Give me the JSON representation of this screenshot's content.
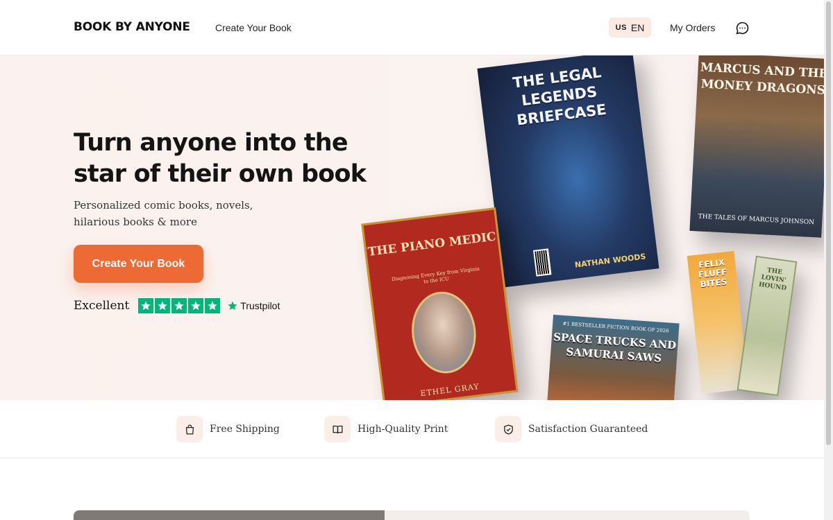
{
  "header": {
    "logo": "BOOK BY ANYONE",
    "nav_create": "Create Your Book",
    "lang_flag": "US",
    "lang_code": "EN",
    "my_orders": "My Orders",
    "chat_icon": "chat-bubble-icon"
  },
  "hero": {
    "title": "Turn anyone into the star of their own book",
    "subtitle": "Personalized comic books, novels, hilarious books & more",
    "cta": "Create Your Book",
    "rating_label": "Excellent",
    "trustpilot": "Trustpilot",
    "star_color": "#00b67a",
    "accent_color": "#ee6a35"
  },
  "books": {
    "legal": {
      "title": "THE LEGAL LEGENDS BRIEFCASE",
      "author": "NATHAN WOODS"
    },
    "marcus": {
      "title": "MARCUS AND THE MONEY DRAGONS",
      "tagline": "THE TALES OF MARCUS JOHNSON"
    },
    "piano": {
      "title": "THE PIANO MEDIC",
      "subtitle": "Diagnosing Every Key from Virginia to the ICU",
      "author": "ETHEL GRAY"
    },
    "space": {
      "tagline": "#1 BESTSELLER FICTION BOOK OF 2026",
      "title": "SPACE TRUCKS AND SAMURAI SAWS"
    },
    "felix": {
      "title": "FELIX FLUFF BITES"
    },
    "lovin": {
      "title": "THE LOVIN' HOUND"
    }
  },
  "features": [
    {
      "icon": "shopping-bag-icon",
      "label": "Free Shipping"
    },
    {
      "icon": "open-book-icon",
      "label": "High-Quality Print"
    },
    {
      "icon": "shield-check-icon",
      "label": "Satisfaction Guaranteed"
    }
  ]
}
